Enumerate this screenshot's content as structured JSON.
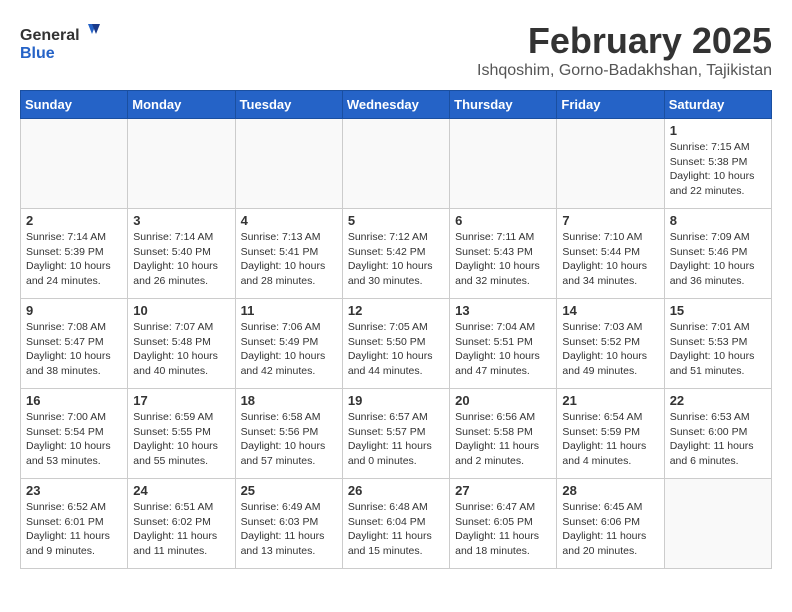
{
  "header": {
    "logo_line1": "General",
    "logo_line2": "Blue",
    "month_year": "February 2025",
    "location": "Ishqoshim, Gorno-Badakhshan, Tajikistan"
  },
  "days_of_week": [
    "Sunday",
    "Monday",
    "Tuesday",
    "Wednesday",
    "Thursday",
    "Friday",
    "Saturday"
  ],
  "weeks": [
    [
      {
        "day": "",
        "info": ""
      },
      {
        "day": "",
        "info": ""
      },
      {
        "day": "",
        "info": ""
      },
      {
        "day": "",
        "info": ""
      },
      {
        "day": "",
        "info": ""
      },
      {
        "day": "",
        "info": ""
      },
      {
        "day": "1",
        "info": "Sunrise: 7:15 AM\nSunset: 5:38 PM\nDaylight: 10 hours and 22 minutes."
      }
    ],
    [
      {
        "day": "2",
        "info": "Sunrise: 7:14 AM\nSunset: 5:39 PM\nDaylight: 10 hours and 24 minutes."
      },
      {
        "day": "3",
        "info": "Sunrise: 7:14 AM\nSunset: 5:40 PM\nDaylight: 10 hours and 26 minutes."
      },
      {
        "day": "4",
        "info": "Sunrise: 7:13 AM\nSunset: 5:41 PM\nDaylight: 10 hours and 28 minutes."
      },
      {
        "day": "5",
        "info": "Sunrise: 7:12 AM\nSunset: 5:42 PM\nDaylight: 10 hours and 30 minutes."
      },
      {
        "day": "6",
        "info": "Sunrise: 7:11 AM\nSunset: 5:43 PM\nDaylight: 10 hours and 32 minutes."
      },
      {
        "day": "7",
        "info": "Sunrise: 7:10 AM\nSunset: 5:44 PM\nDaylight: 10 hours and 34 minutes."
      },
      {
        "day": "8",
        "info": "Sunrise: 7:09 AM\nSunset: 5:46 PM\nDaylight: 10 hours and 36 minutes."
      }
    ],
    [
      {
        "day": "9",
        "info": "Sunrise: 7:08 AM\nSunset: 5:47 PM\nDaylight: 10 hours and 38 minutes."
      },
      {
        "day": "10",
        "info": "Sunrise: 7:07 AM\nSunset: 5:48 PM\nDaylight: 10 hours and 40 minutes."
      },
      {
        "day": "11",
        "info": "Sunrise: 7:06 AM\nSunset: 5:49 PM\nDaylight: 10 hours and 42 minutes."
      },
      {
        "day": "12",
        "info": "Sunrise: 7:05 AM\nSunset: 5:50 PM\nDaylight: 10 hours and 44 minutes."
      },
      {
        "day": "13",
        "info": "Sunrise: 7:04 AM\nSunset: 5:51 PM\nDaylight: 10 hours and 47 minutes."
      },
      {
        "day": "14",
        "info": "Sunrise: 7:03 AM\nSunset: 5:52 PM\nDaylight: 10 hours and 49 minutes."
      },
      {
        "day": "15",
        "info": "Sunrise: 7:01 AM\nSunset: 5:53 PM\nDaylight: 10 hours and 51 minutes."
      }
    ],
    [
      {
        "day": "16",
        "info": "Sunrise: 7:00 AM\nSunset: 5:54 PM\nDaylight: 10 hours and 53 minutes."
      },
      {
        "day": "17",
        "info": "Sunrise: 6:59 AM\nSunset: 5:55 PM\nDaylight: 10 hours and 55 minutes."
      },
      {
        "day": "18",
        "info": "Sunrise: 6:58 AM\nSunset: 5:56 PM\nDaylight: 10 hours and 57 minutes."
      },
      {
        "day": "19",
        "info": "Sunrise: 6:57 AM\nSunset: 5:57 PM\nDaylight: 11 hours and 0 minutes."
      },
      {
        "day": "20",
        "info": "Sunrise: 6:56 AM\nSunset: 5:58 PM\nDaylight: 11 hours and 2 minutes."
      },
      {
        "day": "21",
        "info": "Sunrise: 6:54 AM\nSunset: 5:59 PM\nDaylight: 11 hours and 4 minutes."
      },
      {
        "day": "22",
        "info": "Sunrise: 6:53 AM\nSunset: 6:00 PM\nDaylight: 11 hours and 6 minutes."
      }
    ],
    [
      {
        "day": "23",
        "info": "Sunrise: 6:52 AM\nSunset: 6:01 PM\nDaylight: 11 hours and 9 minutes."
      },
      {
        "day": "24",
        "info": "Sunrise: 6:51 AM\nSunset: 6:02 PM\nDaylight: 11 hours and 11 minutes."
      },
      {
        "day": "25",
        "info": "Sunrise: 6:49 AM\nSunset: 6:03 PM\nDaylight: 11 hours and 13 minutes."
      },
      {
        "day": "26",
        "info": "Sunrise: 6:48 AM\nSunset: 6:04 PM\nDaylight: 11 hours and 15 minutes."
      },
      {
        "day": "27",
        "info": "Sunrise: 6:47 AM\nSunset: 6:05 PM\nDaylight: 11 hours and 18 minutes."
      },
      {
        "day": "28",
        "info": "Sunrise: 6:45 AM\nSunset: 6:06 PM\nDaylight: 11 hours and 20 minutes."
      },
      {
        "day": "",
        "info": ""
      }
    ]
  ]
}
